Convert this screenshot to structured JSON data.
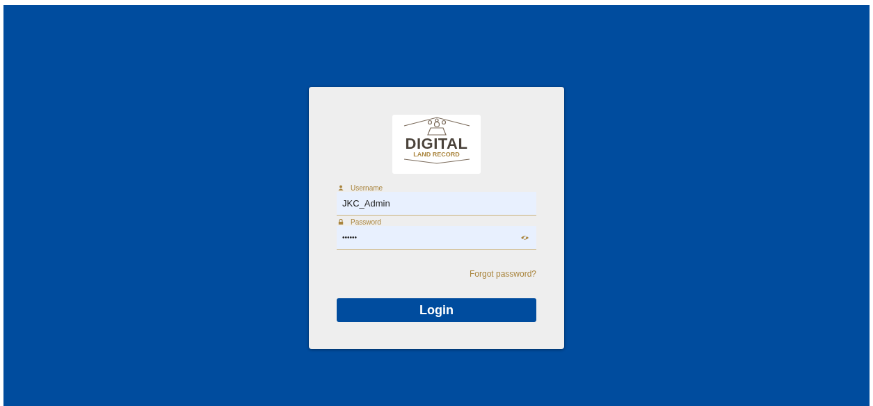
{
  "logo": {
    "title": "DIGITAL",
    "subtitle": "LAND RECORD"
  },
  "fields": [
    {
      "kind": "user",
      "label": "Username",
      "value": "JKC_Admin"
    },
    {
      "kind": "password",
      "label": "Password",
      "value": "••••••"
    }
  ],
  "forgot_link": "Forgot password?",
  "login_button": "Login"
}
